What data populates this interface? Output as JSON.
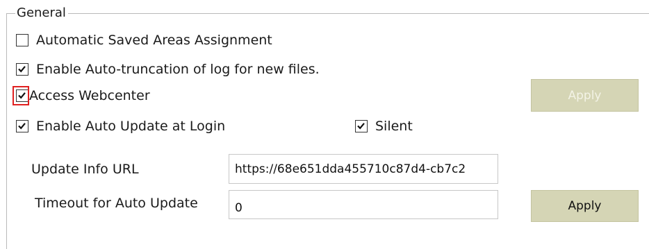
{
  "group": {
    "title": "General"
  },
  "checkboxes": [
    {
      "label": "Automatic Saved Areas Assignment",
      "checked": false
    },
    {
      "label": "Enable Auto-truncation of log for new files.",
      "checked": true
    },
    {
      "label": "Access Webcenter",
      "checked": true,
      "highlighted": true
    },
    {
      "label": "Enable Auto Update at Login",
      "checked": true
    },
    {
      "label": "Silent",
      "checked": true
    }
  ],
  "webcenter_apply": {
    "label": "Apply",
    "enabled": false
  },
  "update_info_url": {
    "label": "Update Info URL",
    "value": "https://68e651dda455710c87d4-cb7c2"
  },
  "timeout": {
    "label": "Timeout for Auto Update",
    "value": "0"
  },
  "auto_update_apply": {
    "label": "Apply",
    "enabled": true
  },
  "colors": {
    "button_bg": "#d5d5b5",
    "disabled_text": "#f3f3e6",
    "highlight": "#e02020",
    "group_border": "#b9b9b9"
  }
}
